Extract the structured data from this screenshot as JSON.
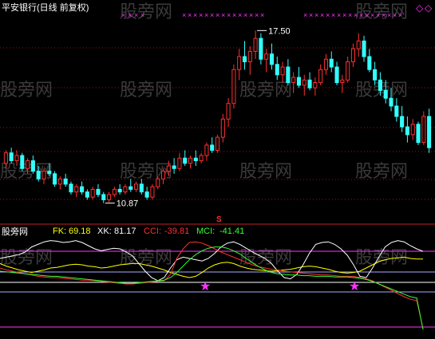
{
  "window": {
    "title": "平安银行(日线 前复权)",
    "indicator_panel_title": "股旁网",
    "watermark": "股旁网",
    "signal_marker": "S"
  },
  "price_annotations": {
    "high_label": "17.50",
    "low_label": "10.87"
  },
  "indicators": {
    "fk": {
      "label": "FK:",
      "value": "69.18",
      "color": "#ffff00"
    },
    "xk": {
      "label": "XK:",
      "value": "81.17",
      "color": "#ffffff"
    },
    "cci": {
      "label": "CCI:",
      "value": "-39.81",
      "color": "#ff3030"
    },
    "mci": {
      "label": "MCI:",
      "value": "-41.41",
      "color": "#33ff33"
    }
  },
  "colors": {
    "background": "#000000",
    "up_candle": "#ff3030",
    "down_candle": "#33ffff",
    "grid_dotted": "#a01010",
    "panel_border": "#c02020",
    "top_markers": "#ff33ff",
    "star": "#ff33ff",
    "level_white": "#ffffff",
    "level_magenta": "#ff33ff",
    "level_lightblue": "#aaaaff",
    "title_text": "#ffffff"
  },
  "chart_data": [
    {
      "type": "candlestick",
      "title": "平安银行(日线 前复权)",
      "ylim": [
        10.4,
        18.0
      ],
      "max_label": "17.50",
      "min_label": "10.87",
      "candles": [
        [
          12.4,
          12.9,
          12.2,
          12.8
        ],
        [
          12.8,
          13.0,
          12.4,
          12.5
        ],
        [
          12.5,
          12.9,
          12.3,
          12.7
        ],
        [
          12.7,
          12.8,
          12.1,
          12.2
        ],
        [
          12.2,
          12.6,
          12.0,
          12.5
        ],
        [
          12.5,
          12.7,
          12.0,
          12.1
        ],
        [
          12.1,
          12.3,
          11.7,
          11.8
        ],
        [
          11.8,
          12.2,
          11.6,
          12.1
        ],
        [
          12.1,
          12.4,
          11.9,
          12.0
        ],
        [
          12.0,
          12.1,
          11.5,
          11.6
        ],
        [
          11.6,
          11.9,
          11.4,
          11.8
        ],
        [
          11.8,
          12.0,
          11.5,
          11.6
        ],
        [
          11.6,
          11.7,
          11.2,
          11.3
        ],
        [
          11.3,
          11.6,
          11.1,
          11.5
        ],
        [
          11.5,
          11.7,
          11.2,
          11.3
        ],
        [
          11.3,
          11.4,
          11.0,
          11.1
        ],
        [
          11.1,
          11.5,
          11.0,
          11.4
        ],
        [
          11.4,
          11.6,
          11.1,
          11.2
        ],
        [
          11.2,
          11.3,
          10.87,
          11.0
        ],
        [
          11.0,
          11.3,
          10.9,
          11.2
        ],
        [
          11.2,
          11.5,
          11.1,
          11.4
        ],
        [
          11.4,
          11.6,
          11.2,
          11.3
        ],
        [
          11.3,
          11.6,
          11.2,
          11.5
        ],
        [
          11.5,
          11.8,
          11.3,
          11.4
        ],
        [
          11.4,
          11.7,
          11.3,
          11.6
        ],
        [
          11.6,
          11.8,
          11.2,
          11.3
        ],
        [
          11.3,
          11.5,
          11.0,
          11.1
        ],
        [
          11.1,
          11.6,
          11.0,
          11.5
        ],
        [
          11.5,
          11.9,
          11.4,
          11.8
        ],
        [
          11.8,
          12.2,
          11.6,
          12.1
        ],
        [
          12.1,
          12.5,
          11.9,
          12.3
        ],
        [
          12.3,
          12.6,
          12.0,
          12.2
        ],
        [
          12.2,
          12.8,
          12.1,
          12.6
        ],
        [
          12.6,
          12.9,
          12.3,
          12.4
        ],
        [
          12.4,
          12.7,
          12.2,
          12.6
        ],
        [
          12.6,
          12.9,
          12.3,
          12.5
        ],
        [
          12.5,
          12.8,
          12.4,
          12.7
        ],
        [
          12.7,
          13.2,
          12.5,
          13.1
        ],
        [
          13.1,
          13.4,
          12.8,
          12.9
        ],
        [
          12.9,
          13.5,
          12.8,
          13.4
        ],
        [
          13.4,
          14.3,
          13.2,
          14.1
        ],
        [
          14.1,
          14.9,
          13.8,
          14.7
        ],
        [
          14.7,
          16.2,
          14.5,
          16.0
        ],
        [
          16.0,
          16.8,
          15.6,
          16.5
        ],
        [
          16.5,
          17.1,
          16.0,
          16.3
        ],
        [
          16.3,
          16.9,
          15.8,
          16.7
        ],
        [
          16.7,
          17.5,
          16.4,
          17.2
        ],
        [
          17.2,
          17.4,
          16.2,
          16.4
        ],
        [
          16.4,
          16.8,
          15.9,
          16.6
        ],
        [
          16.6,
          17.0,
          16.0,
          16.2
        ],
        [
          16.2,
          16.5,
          15.6,
          15.8
        ],
        [
          15.8,
          16.3,
          15.5,
          16.1
        ],
        [
          16.1,
          16.4,
          15.4,
          15.5
        ],
        [
          15.5,
          15.9,
          15.1,
          15.7
        ],
        [
          15.7,
          16.1,
          15.3,
          15.4
        ],
        [
          15.4,
          15.8,
          15.0,
          15.6
        ],
        [
          15.6,
          15.9,
          15.2,
          15.3
        ],
        [
          15.3,
          15.7,
          15.0,
          15.5
        ],
        [
          15.5,
          16.2,
          15.4,
          16.0
        ],
        [
          16.0,
          16.6,
          15.8,
          16.4
        ],
        [
          16.4,
          16.7,
          15.9,
          16.1
        ],
        [
          16.1,
          16.3,
          15.4,
          15.5
        ],
        [
          15.5,
          15.8,
          15.1,
          15.6
        ],
        [
          15.6,
          16.5,
          15.5,
          16.3
        ],
        [
          16.3,
          17.0,
          16.1,
          16.8
        ],
        [
          16.8,
          17.4,
          16.5,
          17.1
        ],
        [
          17.1,
          17.3,
          16.3,
          16.5
        ],
        [
          16.5,
          16.8,
          15.9,
          16.0
        ],
        [
          16.0,
          16.3,
          15.4,
          15.6
        ],
        [
          15.6,
          15.9,
          15.0,
          15.2
        ],
        [
          15.2,
          15.6,
          14.7,
          14.9
        ],
        [
          14.9,
          15.3,
          14.4,
          14.6
        ],
        [
          14.6,
          14.9,
          14.0,
          14.2
        ],
        [
          14.2,
          14.6,
          13.6,
          13.8
        ],
        [
          13.8,
          14.2,
          13.2,
          13.5
        ],
        [
          13.5,
          14.1,
          13.3,
          13.9
        ],
        [
          13.9,
          14.0,
          13.1,
          13.2
        ],
        [
          13.2,
          14.4,
          13.1,
          14.2
        ],
        [
          14.2,
          14.5,
          12.8,
          13.0
        ]
      ]
    },
    {
      "type": "line",
      "title": "股旁网",
      "series": [
        {
          "name": "FK",
          "color": "#ffff00",
          "values": [
            62,
            58,
            55,
            52,
            50,
            48,
            50,
            52,
            55,
            56,
            58,
            60,
            61,
            60,
            58,
            57,
            55,
            56,
            58,
            60,
            61,
            62,
            62,
            60,
            58,
            55,
            52,
            48,
            45,
            42,
            40,
            42,
            48,
            55,
            60,
            63,
            64,
            62,
            58,
            55,
            53,
            52,
            51,
            50,
            51,
            52,
            53,
            55,
            57,
            58,
            57,
            55,
            53,
            50,
            48,
            47,
            48,
            50,
            55,
            60,
            65,
            68,
            70,
            71,
            72,
            70,
            69,
            69.18
          ]
        },
        {
          "name": "XK",
          "color": "#ffffff",
          "values": [
            70,
            72,
            74,
            76,
            80,
            88,
            92,
            96,
            98,
            97,
            95,
            96,
            98,
            95,
            90,
            85,
            82,
            84,
            86,
            85,
            80,
            74,
            62,
            50,
            40,
            35,
            40,
            55,
            68,
            72,
            70,
            68,
            66,
            70,
            78,
            88,
            94,
            96,
            92,
            86,
            80,
            75,
            70,
            62,
            50,
            40,
            38,
            45,
            60,
            78,
            92,
            95,
            96,
            92,
            85,
            75,
            60,
            42,
            40,
            55,
            72,
            88,
            95,
            98,
            96,
            90,
            85,
            81.17
          ]
        },
        {
          "name": "CCI",
          "color": "#ff3030",
          "values": [
            55,
            52,
            50,
            48,
            46,
            44,
            42,
            41,
            40,
            40,
            39,
            38,
            37,
            36,
            36,
            35,
            34,
            33,
            32,
            31,
            30,
            30,
            31,
            32,
            33,
            34,
            35,
            45,
            70,
            85,
            95,
            96,
            94,
            90,
            85,
            80,
            76,
            72,
            68,
            64,
            60,
            57,
            55,
            53,
            52,
            50,
            49,
            48,
            47,
            46,
            45,
            44,
            44,
            43,
            42,
            42,
            42,
            40,
            38,
            35,
            30,
            25,
            20,
            15,
            10,
            6,
            4,
            -39.81
          ]
        },
        {
          "name": "MCI",
          "color": "#33ff33",
          "values": [
            50,
            49,
            48,
            47,
            46,
            45,
            44,
            43,
            42,
            42,
            41,
            40,
            39,
            38,
            37,
            36,
            35,
            34,
            33,
            32,
            31,
            31,
            32,
            33,
            34,
            35,
            36,
            40,
            48,
            58,
            68,
            76,
            82,
            86,
            88,
            88,
            86,
            82,
            77,
            70,
            63,
            57,
            52,
            48,
            46,
            45,
            44,
            44,
            43,
            43,
            42,
            42,
            42,
            41,
            41,
            41,
            40,
            39,
            37,
            34,
            30,
            26,
            22,
            18,
            14,
            10,
            8,
            -41.41
          ]
        }
      ]
    }
  ]
}
